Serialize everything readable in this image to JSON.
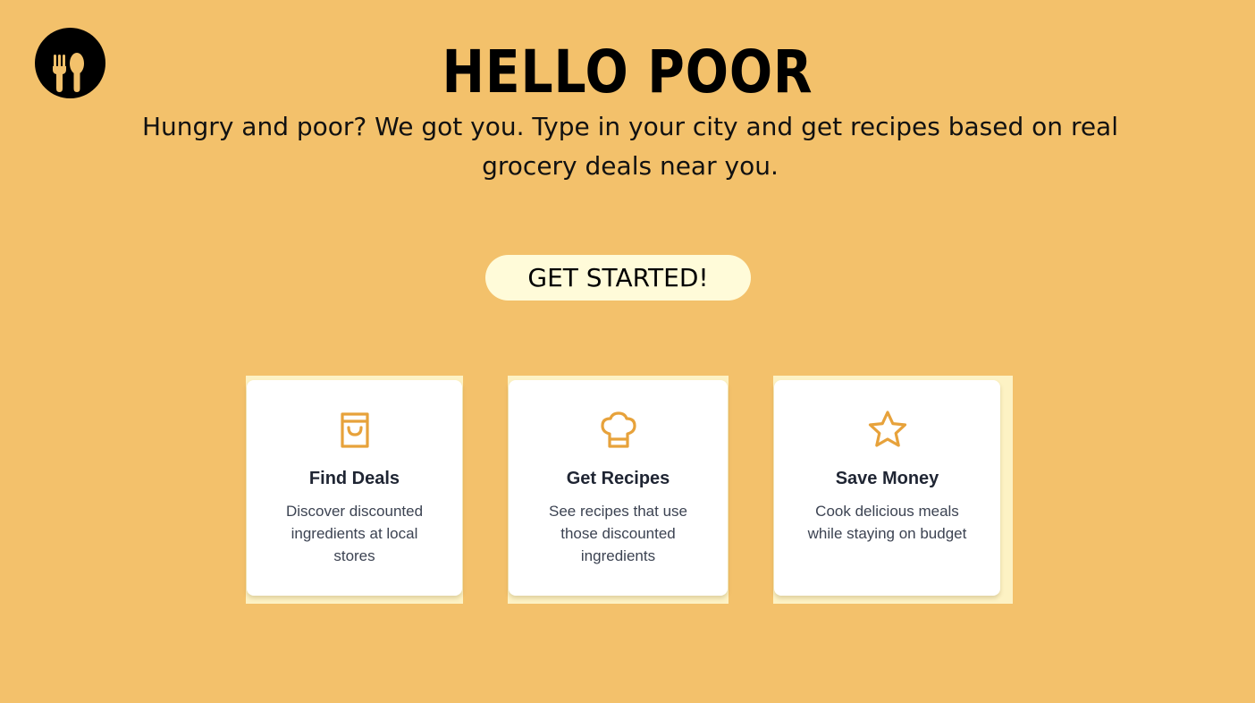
{
  "logo": {
    "icon": "fork-spoon-icon"
  },
  "hero": {
    "title": "HELLO POOR",
    "tagline_line1": "Hungry and poor? We got you. Type in your city and get recipes based on real",
    "tagline_line2": "grocery deals near you."
  },
  "cta": {
    "label": "GET STARTED!"
  },
  "features": [
    {
      "icon": "shopping-bag-icon",
      "title": "Find Deals",
      "desc_lines": [
        "Discover discounted",
        "ingredients at local",
        "stores"
      ]
    },
    {
      "icon": "chef-hat-icon",
      "title": "Get Recipes",
      "desc_lines": [
        "See recipes that use",
        "those discounted",
        "ingredients"
      ]
    },
    {
      "icon": "star-icon",
      "title": "Save Money",
      "desc_lines": [
        "Cook delicious meals",
        "while staying on budget"
      ]
    }
  ],
  "colors": {
    "background": "#f3c16b",
    "accent": "#e7a23b",
    "button": "#fffbd9",
    "card": "#ffffff"
  }
}
